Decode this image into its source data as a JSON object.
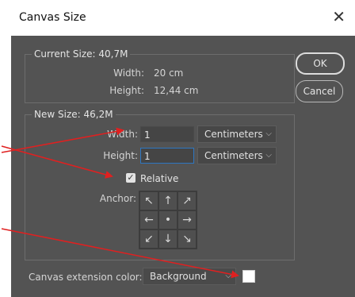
{
  "dialog": {
    "title": "Canvas Size",
    "close_icon": "close-icon"
  },
  "current_size": {
    "legend": "Current Size: 40,7M",
    "width_label": "Width:",
    "width_value": "20 cm",
    "height_label": "Height:",
    "height_value": "12,44 cm"
  },
  "new_size": {
    "legend": "New Size: 46,2M",
    "width_label": "Width:",
    "width_value": "1",
    "width_unit": "Centimeters",
    "height_label": "Height:",
    "height_value": "1",
    "height_unit": "Centimeters",
    "relative_label": "Relative",
    "relative_checked": true,
    "anchor_label": "Anchor:",
    "anchor_icons": [
      "arrow-up-left-icon",
      "arrow-up-icon",
      "arrow-up-right-icon",
      "arrow-left-icon",
      "anchor-center-icon",
      "arrow-right-icon",
      "arrow-down-left-icon",
      "arrow-down-icon",
      "arrow-down-right-icon"
    ]
  },
  "buttons": {
    "ok": "OK",
    "cancel": "Cancel"
  },
  "extension": {
    "label": "Canvas extension color:",
    "value": "Background",
    "swatch_color": "#ffffff"
  },
  "annotations": {
    "arrow_color": "#e02020"
  }
}
